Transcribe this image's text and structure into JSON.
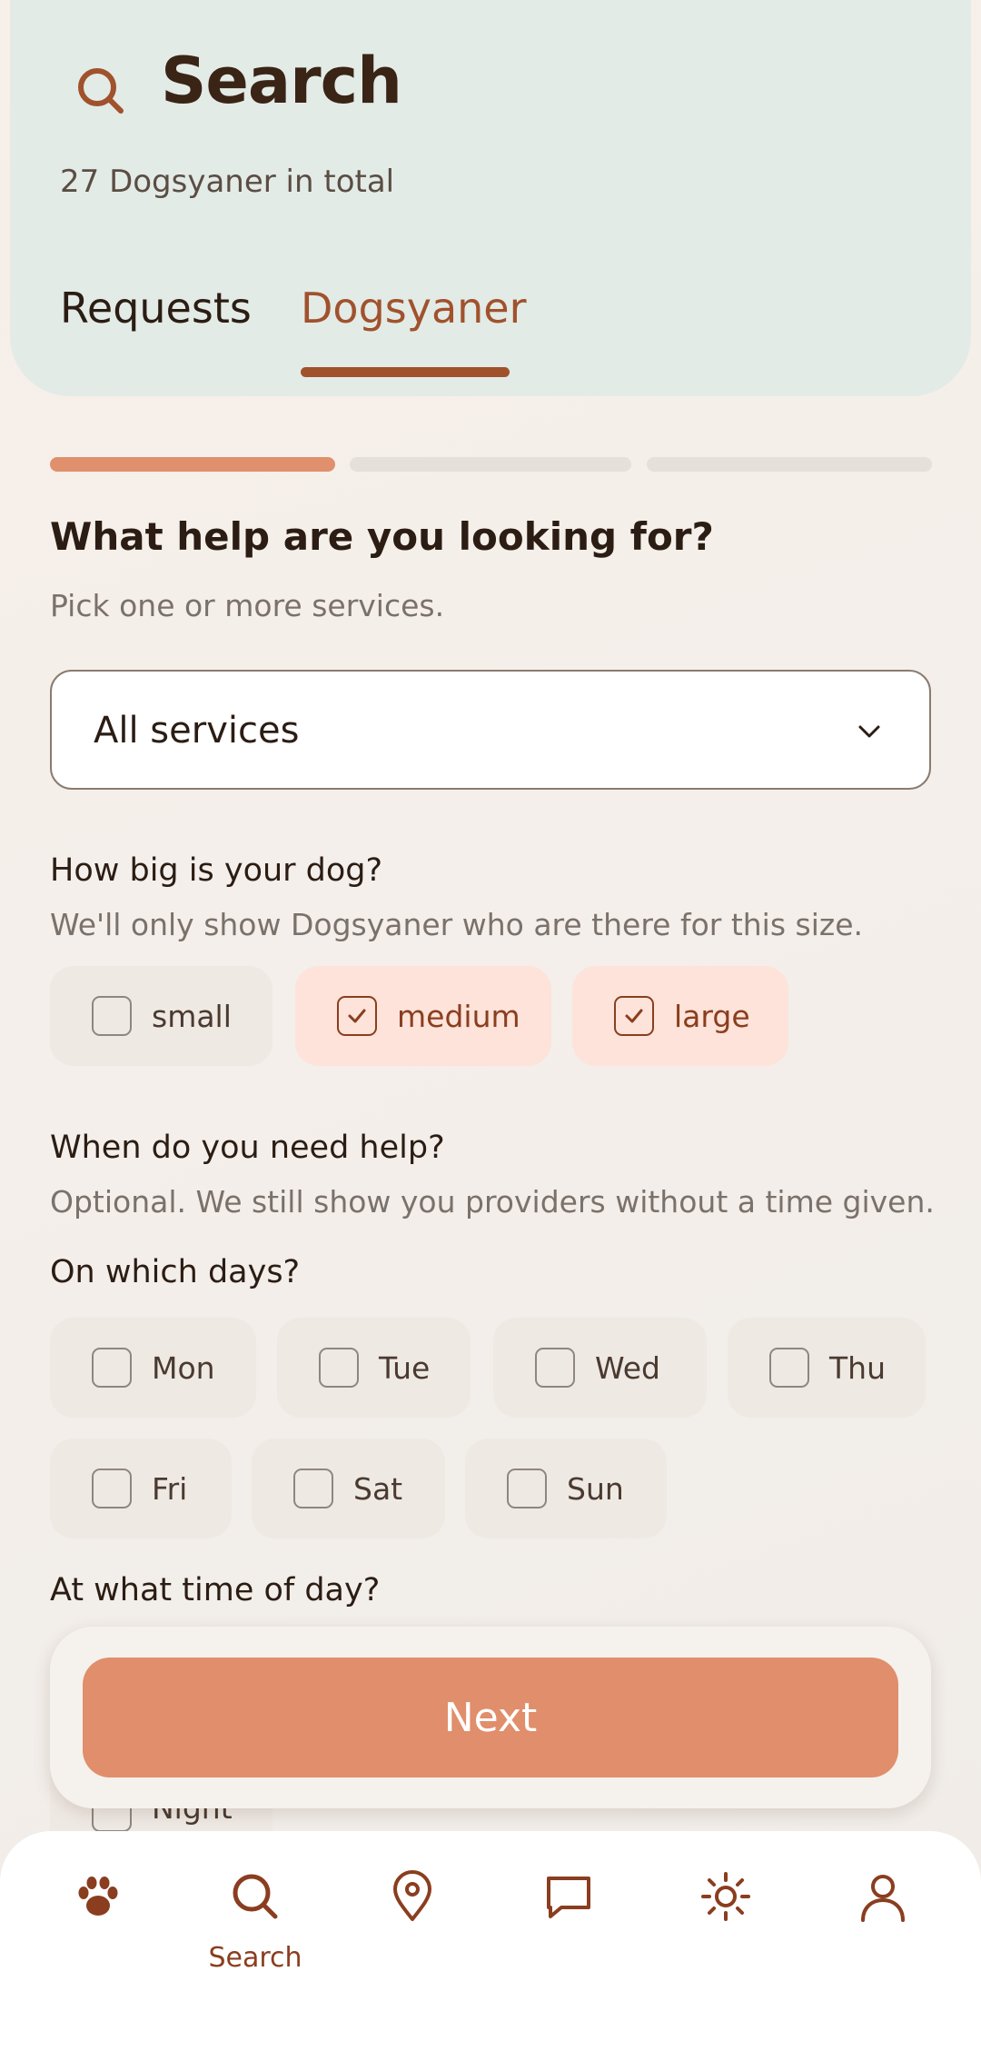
{
  "header": {
    "title": "Search",
    "subtitle": "27 Dogsyaner in total",
    "tabs": [
      {
        "label": "Requests",
        "active": false
      },
      {
        "label": "Dogsyaner",
        "active": true
      }
    ]
  },
  "progress": {
    "current_step": 1,
    "total_steps": 3
  },
  "services": {
    "question": "What help are you looking for?",
    "hint": "Pick one or more services.",
    "selected": "All services"
  },
  "size": {
    "question": "How big is your dog?",
    "hint": "We'll only show Dogsyaner who are there for this size.",
    "options": [
      {
        "label": "small",
        "checked": false
      },
      {
        "label": "medium",
        "checked": true
      },
      {
        "label": "large",
        "checked": true
      }
    ]
  },
  "time": {
    "question": "When do you need help?",
    "hint": "Optional. We still show you providers without a time given.",
    "days_label": "On which days?",
    "days": [
      {
        "label": "Mon",
        "checked": false
      },
      {
        "label": "Tue",
        "checked": false
      },
      {
        "label": "Wed",
        "checked": false
      },
      {
        "label": "Thu",
        "checked": false
      },
      {
        "label": "Fri",
        "checked": false
      },
      {
        "label": "Sat",
        "checked": false
      },
      {
        "label": "Sun",
        "checked": false
      }
    ],
    "time_of_day_label": "At what time of day?",
    "partial_option": "Night"
  },
  "next_button": "Next",
  "bottom_nav": {
    "items": [
      {
        "icon": "paw-icon",
        "label": ""
      },
      {
        "icon": "search-icon",
        "label": "Search",
        "active": true
      },
      {
        "icon": "map-pin-icon",
        "label": ""
      },
      {
        "icon": "chat-icon",
        "label": ""
      },
      {
        "icon": "sun-icon",
        "label": ""
      },
      {
        "icon": "user-icon",
        "label": ""
      }
    ]
  },
  "colors": {
    "accent": "#a0522d",
    "button": "#e08e6b",
    "header_bg": "#e3ebe6",
    "chip_checked_bg": "#fde3d9",
    "chip_bg": "#efe9e4"
  }
}
